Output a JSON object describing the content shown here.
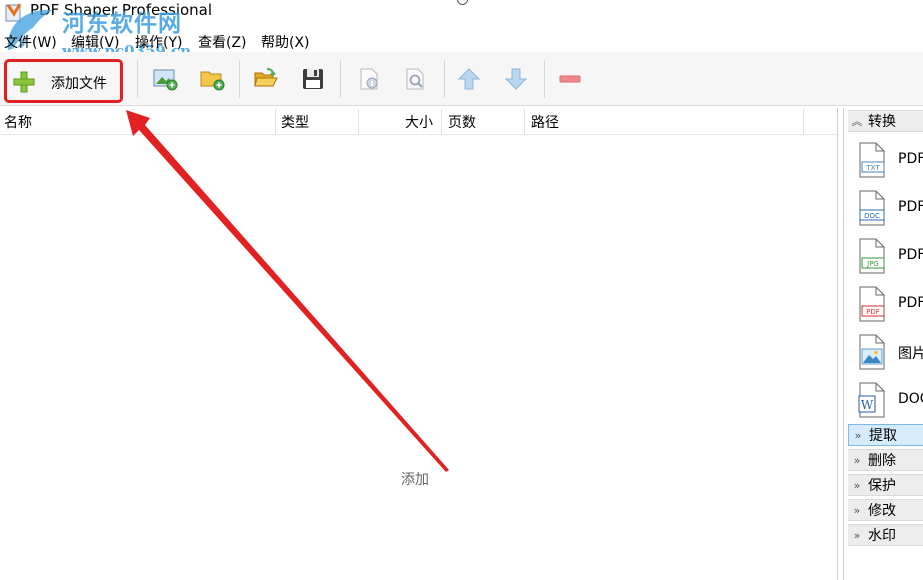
{
  "window": {
    "title": "PDF Shaper Professional"
  },
  "watermark": {
    "text": "河东软件网",
    "url": "www.pc0359.cn"
  },
  "menu": [
    "文件(W)",
    "编辑(V)",
    "操作(Y)",
    "查看(Z)",
    "帮助(X)"
  ],
  "toolbar": {
    "add_file_label": "添加文件",
    "highlight_color": "#e22222"
  },
  "columns": [
    "名称",
    "类型",
    "大小",
    "页数",
    "路径"
  ],
  "empty_hint": "添加",
  "side": {
    "convert_label": "转换",
    "convert_items": [
      {
        "icon": "txt-file-icon",
        "tag": "TXT",
        "label": "PDF"
      },
      {
        "icon": "doc-file-icon",
        "tag": "DOC",
        "label": "PDF"
      },
      {
        "icon": "jpg-file-icon",
        "tag": "JPG",
        "label": "PDF"
      },
      {
        "icon": "pdf-file-icon",
        "tag": "PDF",
        "label": "PDF"
      },
      {
        "icon": "image-file-icon",
        "tag": "",
        "label": "图片"
      },
      {
        "icon": "word-file-icon",
        "tag": "W",
        "label": "DOC"
      }
    ],
    "sections": [
      "提取",
      "删除",
      "保护",
      "修改",
      "水印"
    ]
  },
  "colors": {
    "accent_blue": "#3d9de0",
    "annotation_red": "#e22222",
    "active_section_bg": "#d6ebfb"
  }
}
